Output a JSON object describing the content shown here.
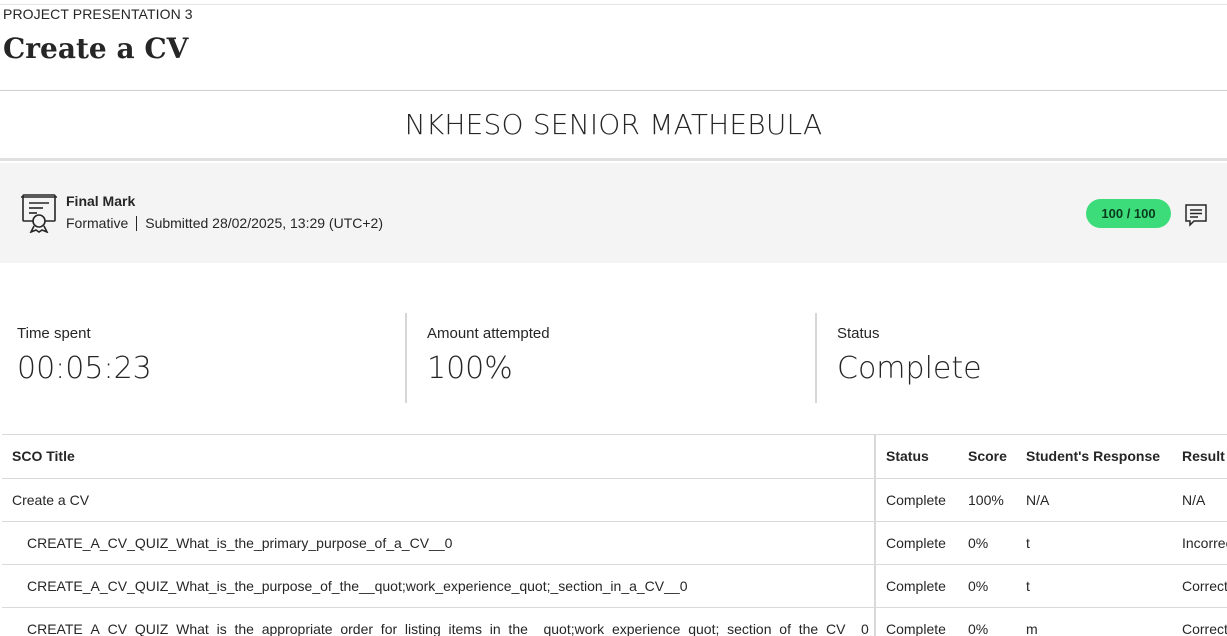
{
  "header": {
    "kicker": "PROJECT PRESENTATION 3",
    "title": "Create a CV"
  },
  "student": {
    "name": "NKHESO SENIOR MATHEBULA"
  },
  "final_mark": {
    "title": "Final Mark",
    "type": "Formative",
    "submitted": "Submitted 28/02/2025, 13:29 (UTC+2)",
    "grade": "100 / 100",
    "grade_color": "#3ddc7a",
    "icons": [
      "certificate-icon",
      "feedback-comment-icon"
    ]
  },
  "stats": [
    {
      "label": "Time spent",
      "value": "00:05:23"
    },
    {
      "label": "Amount attempted",
      "value": "100%"
    },
    {
      "label": "Status",
      "value": "Complete"
    }
  ],
  "table": {
    "headers": {
      "title": "SCO Title",
      "status": "Status",
      "score": "Score",
      "response": "Student's Response",
      "result": "Result"
    },
    "rows": [
      {
        "title": "Create a CV",
        "status": "Complete",
        "score": "100%",
        "response": "N/A",
        "result": "N/A"
      },
      {
        "title": "CREATE_A_CV_QUIZ_What_is_the_primary_purpose_of_a_CV__0",
        "status": "Complete",
        "score": "0%",
        "response": "t",
        "result": "Incorrect"
      },
      {
        "title": "CREATE_A_CV_QUIZ_What_is_the_purpose_of_the__quot;work_experience_quot;_section_in_a_CV__0",
        "status": "Complete",
        "score": "0%",
        "response": "t",
        "result": "Correct"
      },
      {
        "title": "CREATE_A_CV_QUIZ_What_is_the_appropriate_order_for_listing_items_in_the__quot;work_experience_quot;_section_of_the_CV__0",
        "status": "Complete",
        "score": "0%",
        "response": "m",
        "result": "Correct"
      }
    ]
  }
}
